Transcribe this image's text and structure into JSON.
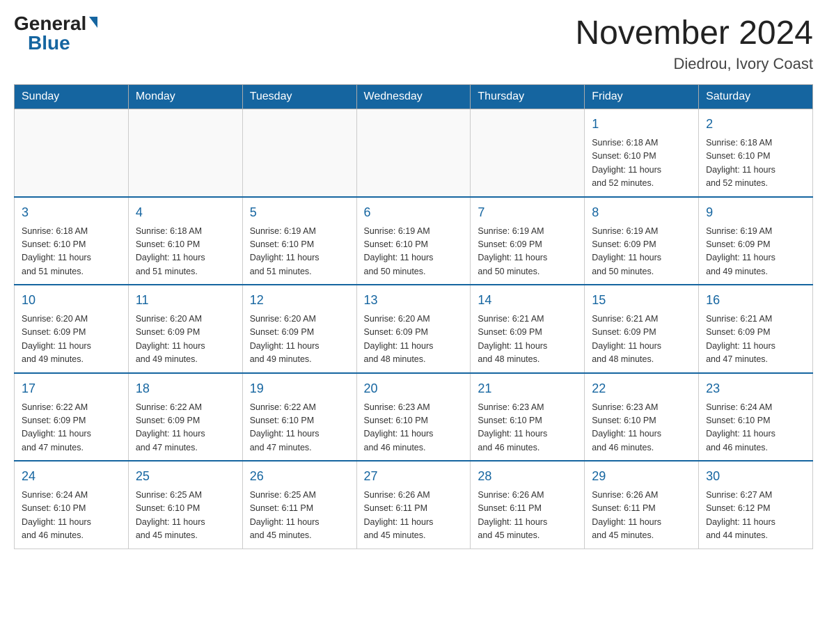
{
  "header": {
    "logo_general": "General",
    "logo_blue": "Blue",
    "main_title": "November 2024",
    "subtitle": "Diedrou, Ivory Coast"
  },
  "days_of_week": [
    "Sunday",
    "Monday",
    "Tuesday",
    "Wednesday",
    "Thursday",
    "Friday",
    "Saturday"
  ],
  "weeks": [
    [
      {
        "day": "",
        "info": ""
      },
      {
        "day": "",
        "info": ""
      },
      {
        "day": "",
        "info": ""
      },
      {
        "day": "",
        "info": ""
      },
      {
        "day": "",
        "info": ""
      },
      {
        "day": "1",
        "info": "Sunrise: 6:18 AM\nSunset: 6:10 PM\nDaylight: 11 hours\nand 52 minutes."
      },
      {
        "day": "2",
        "info": "Sunrise: 6:18 AM\nSunset: 6:10 PM\nDaylight: 11 hours\nand 52 minutes."
      }
    ],
    [
      {
        "day": "3",
        "info": "Sunrise: 6:18 AM\nSunset: 6:10 PM\nDaylight: 11 hours\nand 51 minutes."
      },
      {
        "day": "4",
        "info": "Sunrise: 6:18 AM\nSunset: 6:10 PM\nDaylight: 11 hours\nand 51 minutes."
      },
      {
        "day": "5",
        "info": "Sunrise: 6:19 AM\nSunset: 6:10 PM\nDaylight: 11 hours\nand 51 minutes."
      },
      {
        "day": "6",
        "info": "Sunrise: 6:19 AM\nSunset: 6:10 PM\nDaylight: 11 hours\nand 50 minutes."
      },
      {
        "day": "7",
        "info": "Sunrise: 6:19 AM\nSunset: 6:09 PM\nDaylight: 11 hours\nand 50 minutes."
      },
      {
        "day": "8",
        "info": "Sunrise: 6:19 AM\nSunset: 6:09 PM\nDaylight: 11 hours\nand 50 minutes."
      },
      {
        "day": "9",
        "info": "Sunrise: 6:19 AM\nSunset: 6:09 PM\nDaylight: 11 hours\nand 49 minutes."
      }
    ],
    [
      {
        "day": "10",
        "info": "Sunrise: 6:20 AM\nSunset: 6:09 PM\nDaylight: 11 hours\nand 49 minutes."
      },
      {
        "day": "11",
        "info": "Sunrise: 6:20 AM\nSunset: 6:09 PM\nDaylight: 11 hours\nand 49 minutes."
      },
      {
        "day": "12",
        "info": "Sunrise: 6:20 AM\nSunset: 6:09 PM\nDaylight: 11 hours\nand 49 minutes."
      },
      {
        "day": "13",
        "info": "Sunrise: 6:20 AM\nSunset: 6:09 PM\nDaylight: 11 hours\nand 48 minutes."
      },
      {
        "day": "14",
        "info": "Sunrise: 6:21 AM\nSunset: 6:09 PM\nDaylight: 11 hours\nand 48 minutes."
      },
      {
        "day": "15",
        "info": "Sunrise: 6:21 AM\nSunset: 6:09 PM\nDaylight: 11 hours\nand 48 minutes."
      },
      {
        "day": "16",
        "info": "Sunrise: 6:21 AM\nSunset: 6:09 PM\nDaylight: 11 hours\nand 47 minutes."
      }
    ],
    [
      {
        "day": "17",
        "info": "Sunrise: 6:22 AM\nSunset: 6:09 PM\nDaylight: 11 hours\nand 47 minutes."
      },
      {
        "day": "18",
        "info": "Sunrise: 6:22 AM\nSunset: 6:09 PM\nDaylight: 11 hours\nand 47 minutes."
      },
      {
        "day": "19",
        "info": "Sunrise: 6:22 AM\nSunset: 6:10 PM\nDaylight: 11 hours\nand 47 minutes."
      },
      {
        "day": "20",
        "info": "Sunrise: 6:23 AM\nSunset: 6:10 PM\nDaylight: 11 hours\nand 46 minutes."
      },
      {
        "day": "21",
        "info": "Sunrise: 6:23 AM\nSunset: 6:10 PM\nDaylight: 11 hours\nand 46 minutes."
      },
      {
        "day": "22",
        "info": "Sunrise: 6:23 AM\nSunset: 6:10 PM\nDaylight: 11 hours\nand 46 minutes."
      },
      {
        "day": "23",
        "info": "Sunrise: 6:24 AM\nSunset: 6:10 PM\nDaylight: 11 hours\nand 46 minutes."
      }
    ],
    [
      {
        "day": "24",
        "info": "Sunrise: 6:24 AM\nSunset: 6:10 PM\nDaylight: 11 hours\nand 46 minutes."
      },
      {
        "day": "25",
        "info": "Sunrise: 6:25 AM\nSunset: 6:10 PM\nDaylight: 11 hours\nand 45 minutes."
      },
      {
        "day": "26",
        "info": "Sunrise: 6:25 AM\nSunset: 6:11 PM\nDaylight: 11 hours\nand 45 minutes."
      },
      {
        "day": "27",
        "info": "Sunrise: 6:26 AM\nSunset: 6:11 PM\nDaylight: 11 hours\nand 45 minutes."
      },
      {
        "day": "28",
        "info": "Sunrise: 6:26 AM\nSunset: 6:11 PM\nDaylight: 11 hours\nand 45 minutes."
      },
      {
        "day": "29",
        "info": "Sunrise: 6:26 AM\nSunset: 6:11 PM\nDaylight: 11 hours\nand 45 minutes."
      },
      {
        "day": "30",
        "info": "Sunrise: 6:27 AM\nSunset: 6:12 PM\nDaylight: 11 hours\nand 44 minutes."
      }
    ]
  ]
}
